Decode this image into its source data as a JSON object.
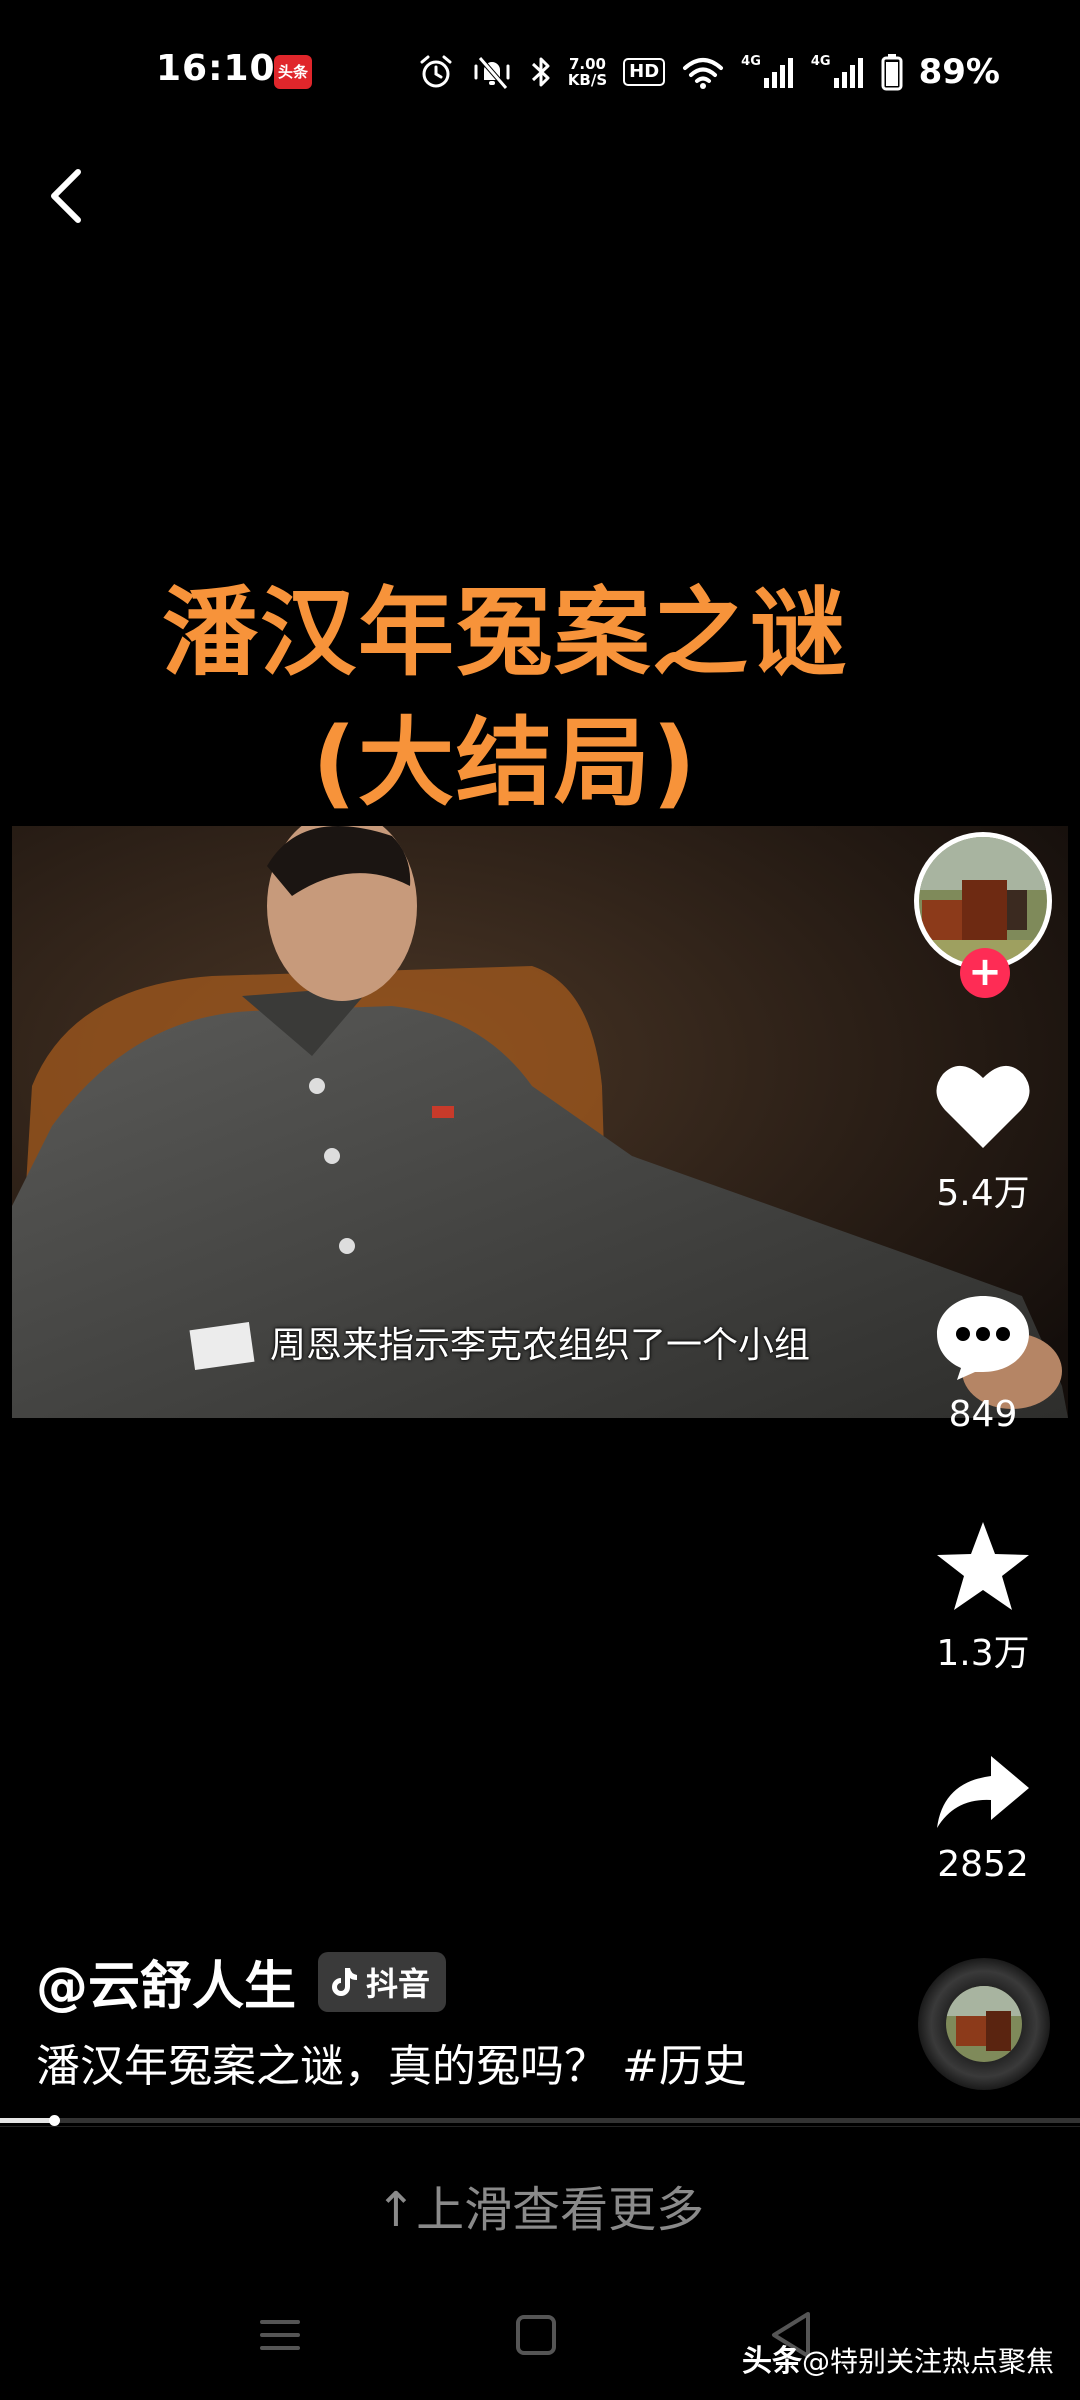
{
  "status_bar": {
    "time": "16:10",
    "app_badge": "头条",
    "net_speed_value": "7.00",
    "net_speed_unit": "KB/S",
    "hd_label": "HD",
    "signal1_label": "4G",
    "signal2_label": "4G",
    "battery": "89%"
  },
  "video": {
    "title_line1": "潘汉年冤案之谜",
    "title_line2": "(大结局)",
    "subtitle": "周恩来指示李克农组织了一个小组",
    "progress": 0.05
  },
  "actions": {
    "likes": "5.4万",
    "comments": "849",
    "favorites": "1.3万",
    "shares": "2852"
  },
  "author": {
    "name": "@云舒人生",
    "platform": "抖音"
  },
  "description": "潘汉年冤案之谜，真的冤吗？ #历史",
  "swipe_hint": "↑上滑查看更多",
  "watermark": {
    "brand": "头条",
    "text": "@特别关注热点聚焦"
  },
  "colors": {
    "title": "#f7933a",
    "follow": "#fe2c55",
    "background": "#000000"
  }
}
